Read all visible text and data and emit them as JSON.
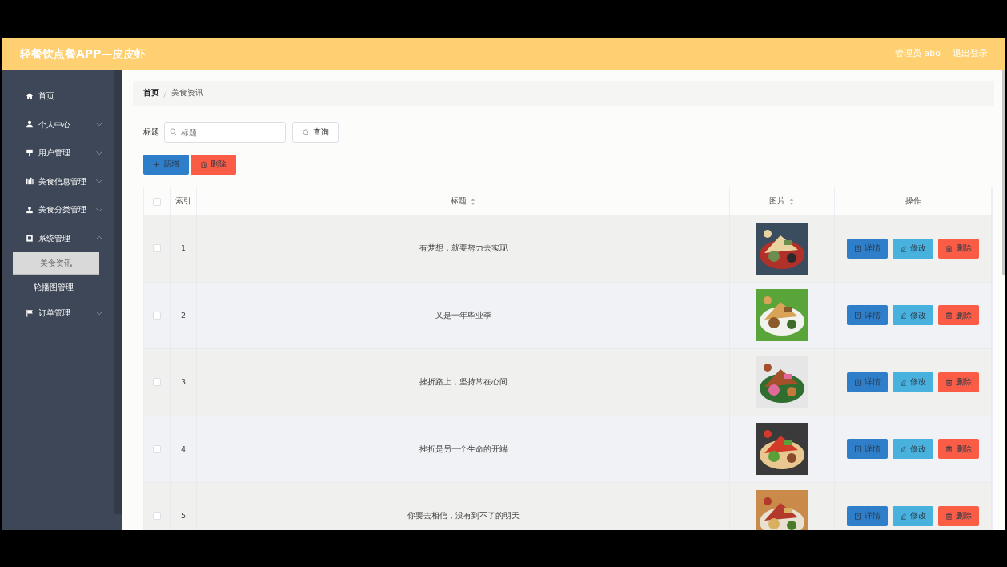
{
  "header": {
    "title": "轻餐饮点餐APP—皮皮虾",
    "user": "管理员 abo",
    "logout": "退出登录"
  },
  "sidebar": {
    "items": [
      {
        "label": "首页",
        "kind": "link"
      },
      {
        "label": "个人中心",
        "kind": "submenu",
        "expanded": false
      },
      {
        "label": "用户管理",
        "kind": "submenu",
        "expanded": false
      },
      {
        "label": "美食信息管理",
        "kind": "submenu",
        "expanded": false
      },
      {
        "label": "美食分类管理",
        "kind": "submenu",
        "expanded": false
      },
      {
        "label": "系统管理",
        "kind": "submenu",
        "expanded": true,
        "children": [
          {
            "label": "美食资讯",
            "selected": true
          },
          {
            "label": "轮播图管理",
            "selected": false
          }
        ]
      },
      {
        "label": "订单管理",
        "kind": "submenu",
        "expanded": false
      }
    ]
  },
  "breadcrumb": [
    "首页",
    "美食资讯"
  ],
  "search": {
    "label": "标题",
    "placeholder": "标题",
    "button": "查询"
  },
  "toolbar": [
    {
      "label": "新增",
      "kind": "add"
    },
    {
      "label": "删除",
      "kind": "delete"
    }
  ],
  "table": {
    "select_all": false,
    "columns": [
      {
        "label": "索引",
        "sortable": false
      },
      {
        "label": "标题",
        "sortable": true
      },
      {
        "label": "图片",
        "sortable": true
      },
      {
        "label": "操作",
        "sortable": false
      }
    ],
    "rows": [
      {
        "checked": false,
        "index": "1",
        "title": "有梦想，就要努力去实现",
        "image": {
          "kind": "picture"
        },
        "actions": [
          {
            "label": "详情",
            "kind": "detail"
          },
          {
            "label": "修改",
            "kind": "edit"
          },
          {
            "label": "删除",
            "kind": "delete"
          }
        ]
      },
      {
        "checked": false,
        "index": "2",
        "title": "又是一年毕业季",
        "image": {
          "kind": "picture"
        },
        "actions": [
          {
            "label": "详情",
            "kind": "detail"
          },
          {
            "label": "修改",
            "kind": "edit"
          },
          {
            "label": "删除",
            "kind": "delete"
          }
        ]
      },
      {
        "checked": false,
        "index": "3",
        "title": "挫折路上，坚持常在心间",
        "image": {
          "kind": "picture"
        },
        "actions": [
          {
            "label": "详情",
            "kind": "detail"
          },
          {
            "label": "修改",
            "kind": "edit"
          },
          {
            "label": "删除",
            "kind": "delete"
          }
        ]
      },
      {
        "checked": false,
        "index": "4",
        "title": "挫折是另一个生命的开端",
        "image": {
          "kind": "picture"
        },
        "actions": [
          {
            "label": "详情",
            "kind": "detail"
          },
          {
            "label": "修改",
            "kind": "edit"
          },
          {
            "label": "删除",
            "kind": "delete"
          }
        ]
      },
      {
        "checked": false,
        "index": "5",
        "title": "你要去相信，没有到不了的明天",
        "image": {
          "kind": "picture"
        },
        "actions": [
          {
            "label": "详情",
            "kind": "detail"
          },
          {
            "label": "修改",
            "kind": "edit"
          },
          {
            "label": "删除",
            "kind": "delete"
          }
        ]
      }
    ]
  }
}
